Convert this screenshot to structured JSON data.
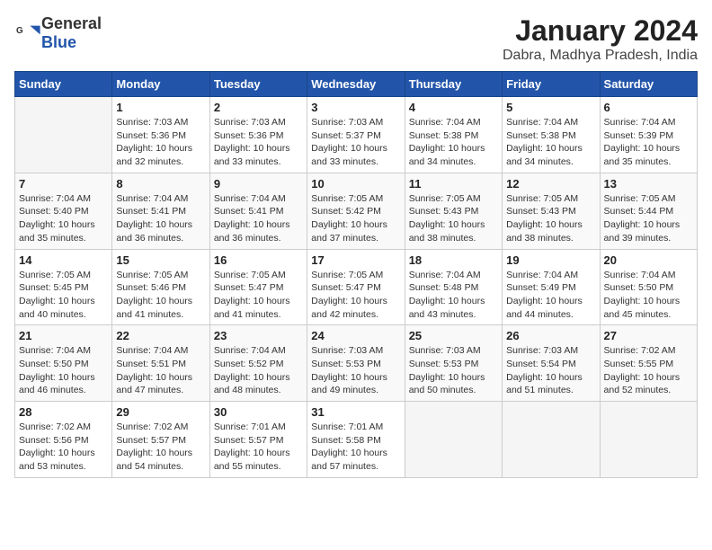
{
  "header": {
    "logo_general": "General",
    "logo_blue": "Blue",
    "month": "January 2024",
    "location": "Dabra, Madhya Pradesh, India"
  },
  "weekdays": [
    "Sunday",
    "Monday",
    "Tuesday",
    "Wednesday",
    "Thursday",
    "Friday",
    "Saturday"
  ],
  "weeks": [
    [
      {
        "day": "",
        "info": ""
      },
      {
        "day": "1",
        "info": "Sunrise: 7:03 AM\nSunset: 5:36 PM\nDaylight: 10 hours\nand 32 minutes."
      },
      {
        "day": "2",
        "info": "Sunrise: 7:03 AM\nSunset: 5:36 PM\nDaylight: 10 hours\nand 33 minutes."
      },
      {
        "day": "3",
        "info": "Sunrise: 7:03 AM\nSunset: 5:37 PM\nDaylight: 10 hours\nand 33 minutes."
      },
      {
        "day": "4",
        "info": "Sunrise: 7:04 AM\nSunset: 5:38 PM\nDaylight: 10 hours\nand 34 minutes."
      },
      {
        "day": "5",
        "info": "Sunrise: 7:04 AM\nSunset: 5:38 PM\nDaylight: 10 hours\nand 34 minutes."
      },
      {
        "day": "6",
        "info": "Sunrise: 7:04 AM\nSunset: 5:39 PM\nDaylight: 10 hours\nand 35 minutes."
      }
    ],
    [
      {
        "day": "7",
        "info": "Sunrise: 7:04 AM\nSunset: 5:40 PM\nDaylight: 10 hours\nand 35 minutes."
      },
      {
        "day": "8",
        "info": "Sunrise: 7:04 AM\nSunset: 5:41 PM\nDaylight: 10 hours\nand 36 minutes."
      },
      {
        "day": "9",
        "info": "Sunrise: 7:04 AM\nSunset: 5:41 PM\nDaylight: 10 hours\nand 36 minutes."
      },
      {
        "day": "10",
        "info": "Sunrise: 7:05 AM\nSunset: 5:42 PM\nDaylight: 10 hours\nand 37 minutes."
      },
      {
        "day": "11",
        "info": "Sunrise: 7:05 AM\nSunset: 5:43 PM\nDaylight: 10 hours\nand 38 minutes."
      },
      {
        "day": "12",
        "info": "Sunrise: 7:05 AM\nSunset: 5:43 PM\nDaylight: 10 hours\nand 38 minutes."
      },
      {
        "day": "13",
        "info": "Sunrise: 7:05 AM\nSunset: 5:44 PM\nDaylight: 10 hours\nand 39 minutes."
      }
    ],
    [
      {
        "day": "14",
        "info": "Sunrise: 7:05 AM\nSunset: 5:45 PM\nDaylight: 10 hours\nand 40 minutes."
      },
      {
        "day": "15",
        "info": "Sunrise: 7:05 AM\nSunset: 5:46 PM\nDaylight: 10 hours\nand 41 minutes."
      },
      {
        "day": "16",
        "info": "Sunrise: 7:05 AM\nSunset: 5:47 PM\nDaylight: 10 hours\nand 41 minutes."
      },
      {
        "day": "17",
        "info": "Sunrise: 7:05 AM\nSunset: 5:47 PM\nDaylight: 10 hours\nand 42 minutes."
      },
      {
        "day": "18",
        "info": "Sunrise: 7:04 AM\nSunset: 5:48 PM\nDaylight: 10 hours\nand 43 minutes."
      },
      {
        "day": "19",
        "info": "Sunrise: 7:04 AM\nSunset: 5:49 PM\nDaylight: 10 hours\nand 44 minutes."
      },
      {
        "day": "20",
        "info": "Sunrise: 7:04 AM\nSunset: 5:50 PM\nDaylight: 10 hours\nand 45 minutes."
      }
    ],
    [
      {
        "day": "21",
        "info": "Sunrise: 7:04 AM\nSunset: 5:50 PM\nDaylight: 10 hours\nand 46 minutes."
      },
      {
        "day": "22",
        "info": "Sunrise: 7:04 AM\nSunset: 5:51 PM\nDaylight: 10 hours\nand 47 minutes."
      },
      {
        "day": "23",
        "info": "Sunrise: 7:04 AM\nSunset: 5:52 PM\nDaylight: 10 hours\nand 48 minutes."
      },
      {
        "day": "24",
        "info": "Sunrise: 7:03 AM\nSunset: 5:53 PM\nDaylight: 10 hours\nand 49 minutes."
      },
      {
        "day": "25",
        "info": "Sunrise: 7:03 AM\nSunset: 5:53 PM\nDaylight: 10 hours\nand 50 minutes."
      },
      {
        "day": "26",
        "info": "Sunrise: 7:03 AM\nSunset: 5:54 PM\nDaylight: 10 hours\nand 51 minutes."
      },
      {
        "day": "27",
        "info": "Sunrise: 7:02 AM\nSunset: 5:55 PM\nDaylight: 10 hours\nand 52 minutes."
      }
    ],
    [
      {
        "day": "28",
        "info": "Sunrise: 7:02 AM\nSunset: 5:56 PM\nDaylight: 10 hours\nand 53 minutes."
      },
      {
        "day": "29",
        "info": "Sunrise: 7:02 AM\nSunset: 5:57 PM\nDaylight: 10 hours\nand 54 minutes."
      },
      {
        "day": "30",
        "info": "Sunrise: 7:01 AM\nSunset: 5:57 PM\nDaylight: 10 hours\nand 55 minutes."
      },
      {
        "day": "31",
        "info": "Sunrise: 7:01 AM\nSunset: 5:58 PM\nDaylight: 10 hours\nand 57 minutes."
      },
      {
        "day": "",
        "info": ""
      },
      {
        "day": "",
        "info": ""
      },
      {
        "day": "",
        "info": ""
      }
    ]
  ]
}
